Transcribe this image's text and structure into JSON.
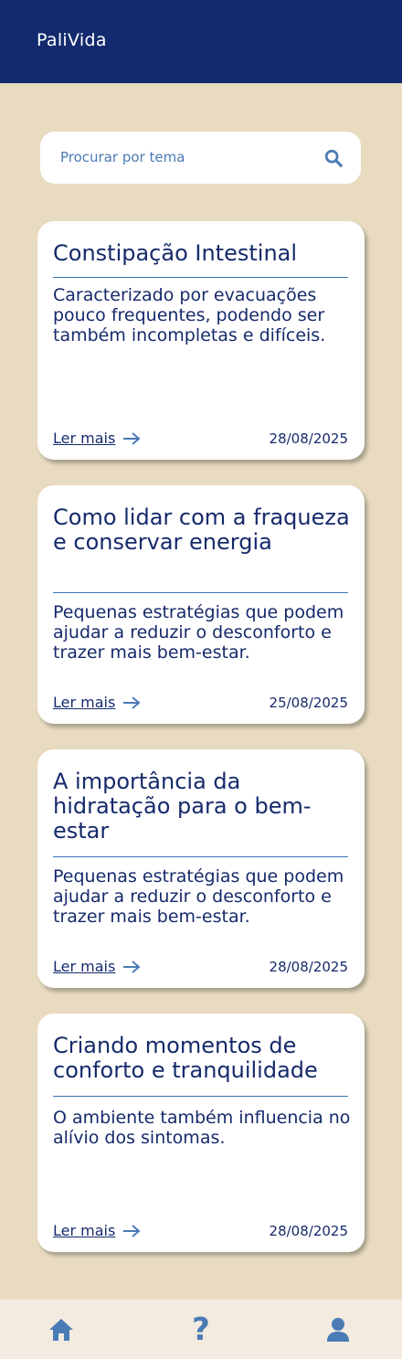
{
  "header": {
    "title": "PaliVida"
  },
  "search": {
    "placeholder": "Procurar por tema",
    "icon": "search-icon"
  },
  "cards": [
    {
      "title": "Constipação Intestinal",
      "description": "Caracterizado por evacuações pouco frequentes, podendo ser também incompletas e difíceis.",
      "link": "Ler mais",
      "date": "28/08/2025"
    },
    {
      "title": "Como lidar com a fraqueza e conservar energia",
      "description": "Pequenas estratégias que podem ajudar a reduzir o desconforto e trazer mais bem-estar.",
      "link": "Ler mais",
      "date": "25/08/2025"
    },
    {
      "title": "A importância da hidratação para o bem-estar",
      "description": "Pequenas estratégias que podem ajudar a reduzir o desconforto e trazer mais bem-estar.",
      "link": "Ler mais",
      "date": "28/08/2025"
    },
    {
      "title": "Criando momentos de conforto e tranquilidade",
      "description": "O ambiente também influencia no alívio dos sintomas.",
      "link": "Ler mais",
      "date": "28/08/2025"
    }
  ],
  "nav": {
    "home_icon": "home-icon",
    "help_icon": "help-icon",
    "help_glyph": "?",
    "profile_icon": "user-icon"
  },
  "colors": {
    "header_bg": "#132a6e",
    "page_bg": "#e8dbc0",
    "text_dark": "#162a6b",
    "accent_blue": "#4a7bb5",
    "nav_bg": "#f3ebe0"
  }
}
